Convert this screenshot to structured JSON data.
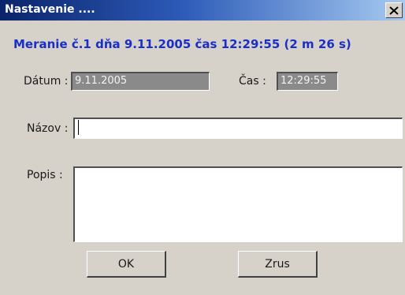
{
  "window": {
    "title": "Nastavenie ....",
    "close_icon": "close-icon"
  },
  "heading": "Meranie č.1 dňa 9.11.2005 čas 12:29:55 (2 m 26 s)",
  "fields": {
    "date_label": "Dátum :",
    "date_value": "9.11.2005",
    "time_label": "Čas :",
    "time_value": "12:29:55",
    "name_label": "Názov :",
    "name_value": "",
    "description_label": "Popis :",
    "description_value": ""
  },
  "buttons": {
    "ok_label": "OK",
    "cancel_label": "Zrus"
  },
  "colors": {
    "title_bar_start": "#0a246a",
    "title_bar_end": "#a6caf0",
    "heading_text": "#1a2fc7",
    "dialog_background": "#d6d2c9",
    "readonly_field_background": "#8a8a8a"
  }
}
